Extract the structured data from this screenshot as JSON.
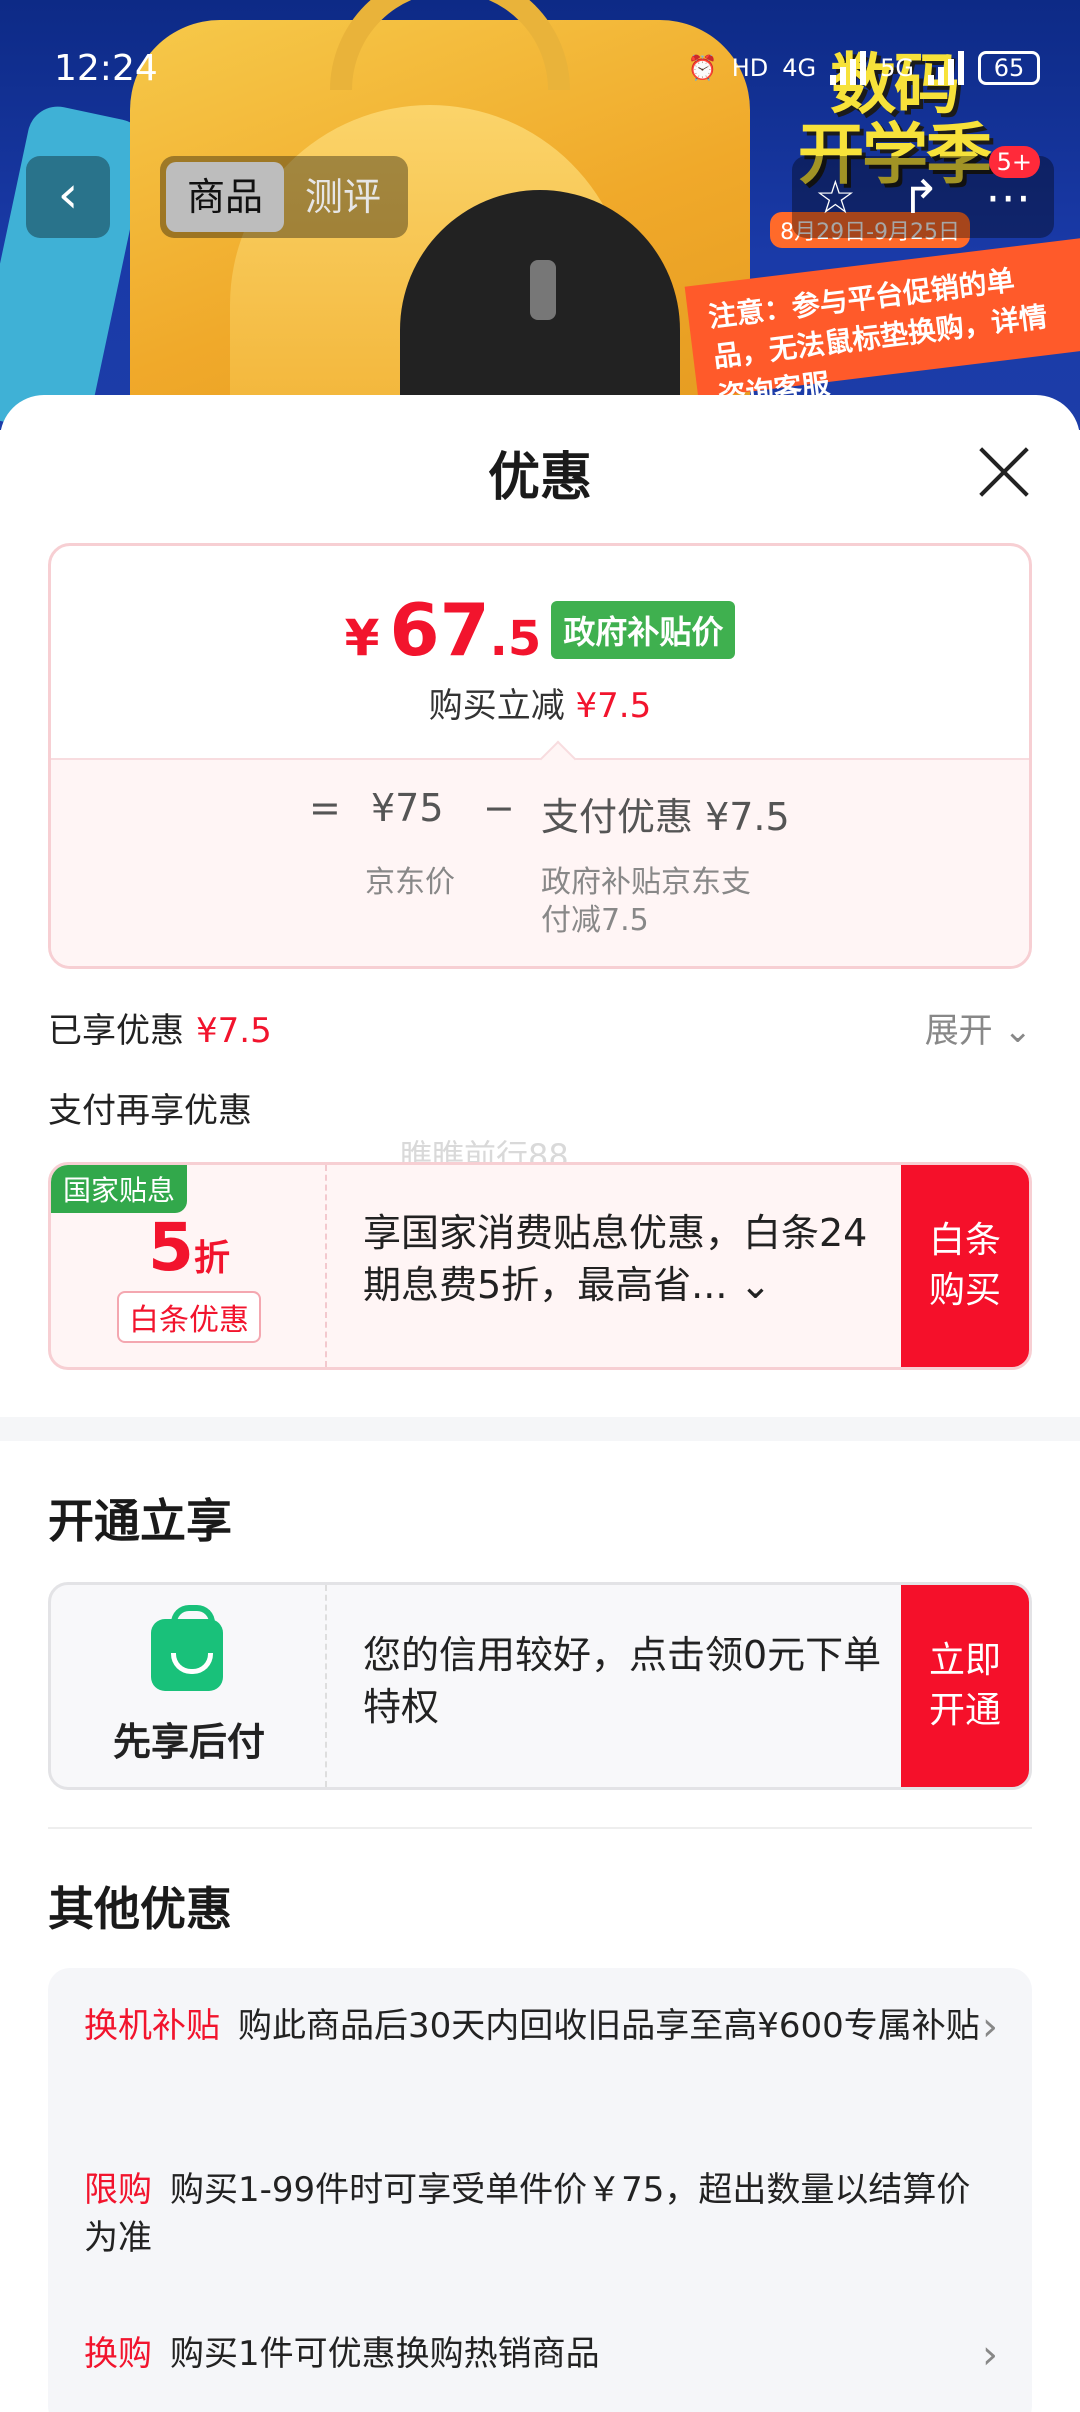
{
  "status_bar": {
    "time": "12:24",
    "hd_label": "HD",
    "net1": "4G",
    "net2": "5G",
    "battery": "65"
  },
  "hero": {
    "promo_title_line1": "数码",
    "promo_title_line2": "开学季",
    "promo_date": "8月29日-9月25日",
    "promo_note": "注意：参与平台促销的单品，无法鼠标垫换购，详情咨询客服"
  },
  "nav": {
    "tabs": [
      "商品",
      "测评"
    ],
    "cart_badge": "5+"
  },
  "sheet": {
    "title": "优惠",
    "price": {
      "currency": "¥",
      "integer": "67",
      "decimal": ".5",
      "tag": "政府补贴价",
      "save_label": "购买立减",
      "save_value": "¥7.5"
    },
    "calc": {
      "eq": "=",
      "base_value": "¥75",
      "base_label": "京东价",
      "minus": "−",
      "discount_value": "支付优惠 ¥7.5",
      "discount_label_line1": "政府补贴京东支",
      "discount_label_line2": "付减7.5"
    },
    "enjoyed_label": "已享优惠",
    "enjoyed_value": "¥7.5",
    "expand_label": "展开",
    "pay_more_label": "支付再享优惠",
    "watermark": "瞧瞧前行88",
    "baitiao": {
      "tag": "国家贴息",
      "discount_num": "5",
      "discount_unit": "折",
      "sub_tag": "白条优惠",
      "text": "享国家消费贴息优惠，白条24期息费5折，最高省...",
      "button_line1": "白条",
      "button_line2": "购买"
    },
    "open_section_title": "开通立享",
    "xianxiang": {
      "label": "先享后付",
      "text": "您的信用较好，点击领0元下单特权",
      "button_line1": "立即",
      "button_line2": "开通"
    },
    "other_title": "其他优惠",
    "offers": [
      {
        "tag": "换机补贴",
        "text": "购此商品后30天内回收旧品享至高¥600专属补贴",
        "has_chevron": true
      },
      {
        "tag": "限购",
        "text": "购买1-99件时可享受单件价￥75，超出数量以结算价为准",
        "has_chevron": false
      },
      {
        "tag": "换购",
        "text": "购买1件可优惠换购热销商品",
        "has_chevron": true
      }
    ]
  }
}
